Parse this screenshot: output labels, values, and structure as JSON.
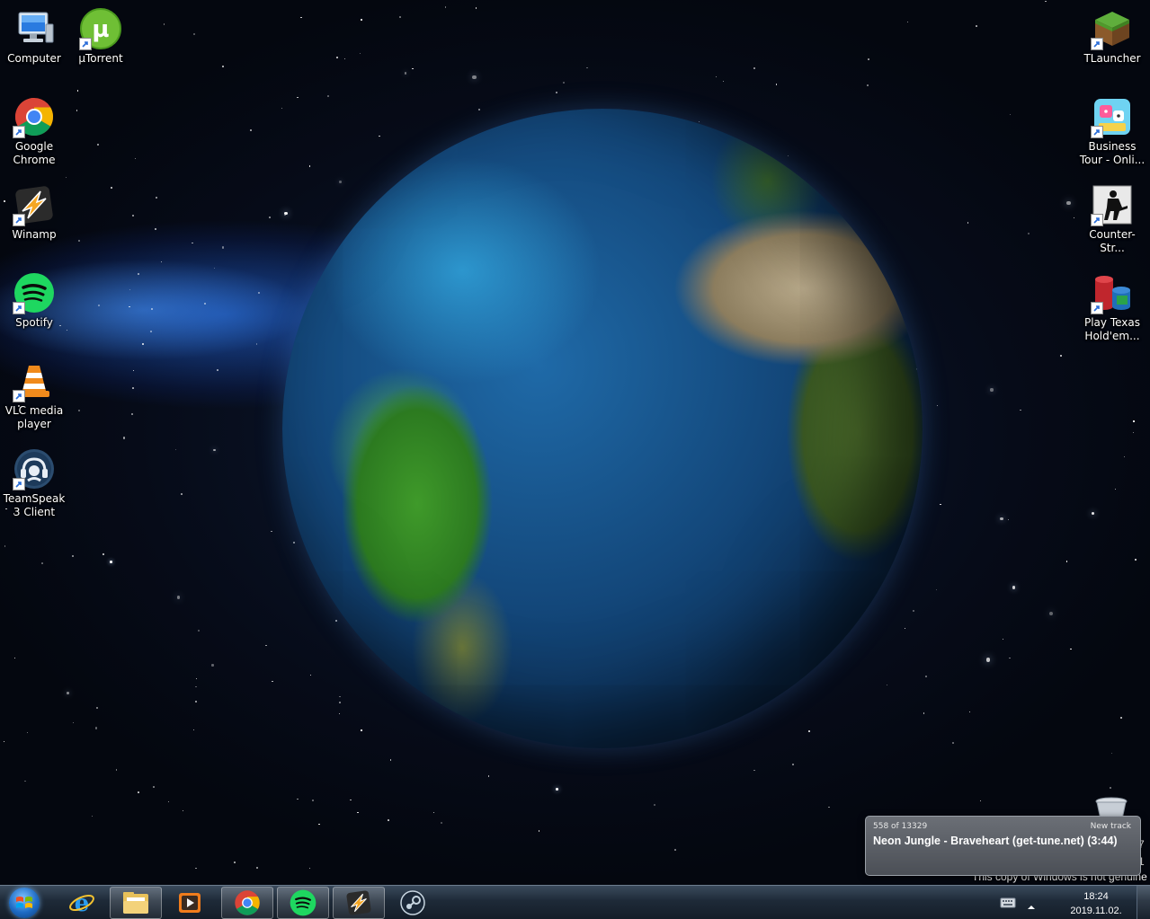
{
  "desktop": {
    "icons_left": [
      {
        "label": "Computer",
        "icon": "computer-icon"
      },
      {
        "label": "µTorrent",
        "icon": "utorrent-icon"
      },
      {
        "label": "Google Chrome",
        "icon": "chrome-icon"
      },
      {
        "label": "Winamp",
        "icon": "winamp-icon"
      },
      {
        "label": "Spotify",
        "icon": "spotify-icon"
      },
      {
        "label": "VLC media player",
        "icon": "vlc-icon"
      },
      {
        "label": "TeamSpeak 3 Client",
        "icon": "teamspeak-icon"
      }
    ],
    "icons_right": [
      {
        "label": "TLauncher",
        "icon": "tlauncher-icon"
      },
      {
        "label": "Business Tour - Onli...",
        "icon": "business-tour-icon"
      },
      {
        "label": "Counter-Str...",
        "icon": "counter-strike-icon"
      },
      {
        "label": "Play Texas Hold'em...",
        "icon": "poker-chips-icon"
      }
    ],
    "recycle_bin_icon": "recycle-bin-icon"
  },
  "toast": {
    "position_text": "558 of 13329",
    "status": "New track",
    "track": "Neon Jungle - Braveheart (get-tune.net) (3:44)"
  },
  "watermark": {
    "genuine_text": "This copy of Windows is not genuine",
    "build_line1": "7",
    "build_line2": "1"
  },
  "taskbar": {
    "start_icon": "windows-start-icon",
    "buttons": [
      {
        "icon": "internet-explorer-icon",
        "active": false
      },
      {
        "icon": "file-explorer-icon",
        "active": true
      },
      {
        "icon": "media-player-icon",
        "active": false
      },
      {
        "icon": "chrome-icon",
        "active": true
      },
      {
        "icon": "spotify-icon",
        "active": true
      },
      {
        "icon": "winamp-icon",
        "active": true
      },
      {
        "icon": "steam-icon",
        "active": false
      }
    ],
    "tray": {
      "keyboard_icon": "keyboard-icon",
      "expand_icon": "chevron-up-icon",
      "time": "18:24",
      "date": "2019.11.02."
    }
  },
  "colors": {
    "taskbar": "#1e2a38",
    "toast_bg": "#5b5f66",
    "spotify_green": "#1ed760",
    "chrome_red": "#db4437",
    "vlc_orange": "#f08a1c"
  }
}
